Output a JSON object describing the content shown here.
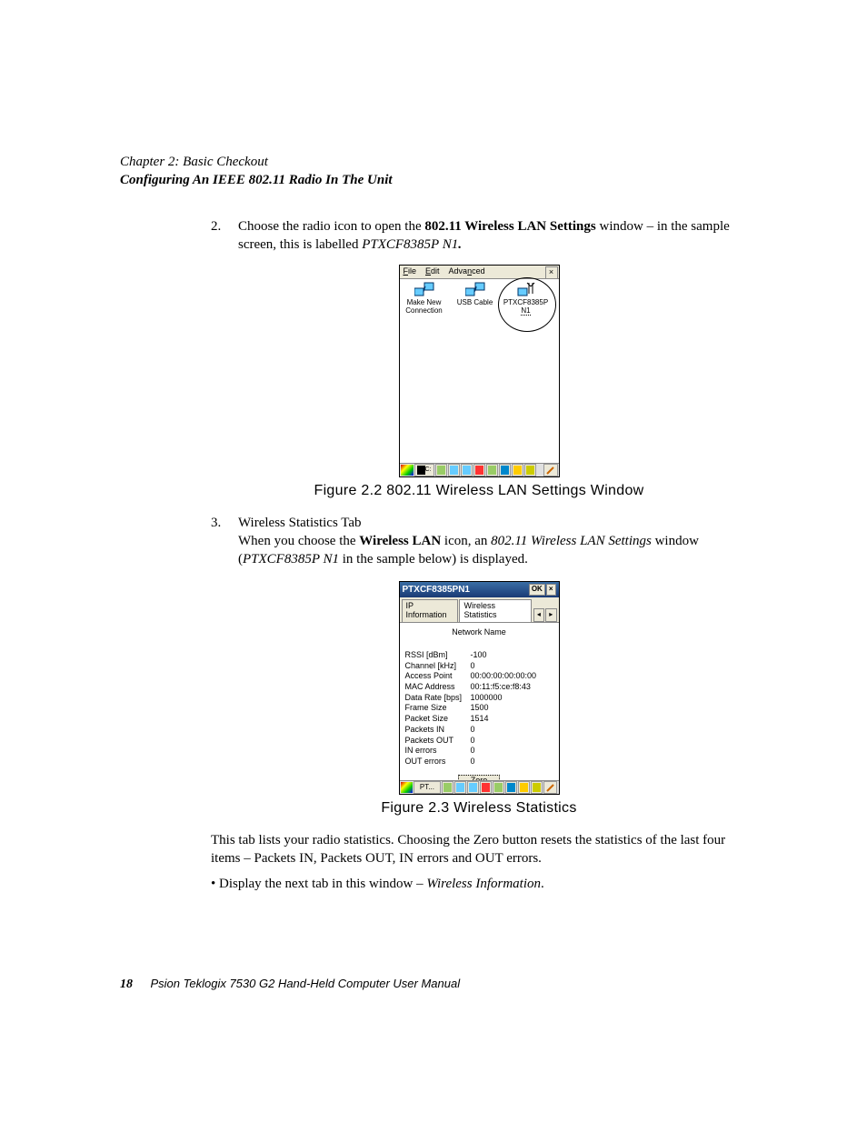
{
  "header": {
    "chapter": "Chapter  2:  Basic Checkout",
    "section": "Configuring An IEEE 802.11 Radio In The Unit"
  },
  "step2": {
    "num": "2.",
    "text_a": "Choose the radio icon to open the ",
    "bold": "802.11 Wireless LAN Settings",
    "text_b": " window – in the sample screen, this is labelled ",
    "italic": "PTXCF8385P N1",
    "period": "."
  },
  "shot1": {
    "menu": {
      "file": "File",
      "edit": "Edit",
      "advanced": "Advanced"
    },
    "close": "×",
    "icons": {
      "makenew_l1": "Make New",
      "makenew_l2": "Connection",
      "usb": "USB Cable",
      "ptx_l1": "PTXCF8385P",
      "ptx_l2": "N1"
    },
    "caption": "Figure 2.2 802.11 Wireless LAN Settings Window"
  },
  "step3": {
    "num": "3.",
    "title": "Wireless Statistics Tab",
    "line2_a": "When you choose the ",
    "line2_bold": "Wireless LAN",
    "line2_b": " icon, an ",
    "line2_i1": "802.11 Wireless LAN Settings",
    "line2_c": " window (",
    "line2_i2": "PTXCF8385P N1",
    "line2_d": " in the sample below) is displayed."
  },
  "shot2": {
    "title": "PTXCF8385PN1",
    "ok": "OK",
    "close": "×",
    "tab1": "IP Information",
    "tab2": "Wireless Statistics",
    "nn": "Network Name",
    "stats": [
      {
        "k": "RSSI [dBm]",
        "v": "-100"
      },
      {
        "k": "Channel [kHz]",
        "v": "0"
      },
      {
        "k": "Access Point",
        "v": "00:00:00:00:00:00"
      },
      {
        "k": "MAC Address",
        "v": "00:11:f5:ce:f8:43"
      },
      {
        "k": "Data Rate [bps]",
        "v": "1000000"
      },
      {
        "k": "Frame Size",
        "v": "1500"
      },
      {
        "k": "Packet Size",
        "v": "1514"
      },
      {
        "k": "Packets IN",
        "v": "0"
      },
      {
        "k": "Packets OUT",
        "v": "0"
      },
      {
        "k": "IN errors",
        "v": "0"
      },
      {
        "k": "OUT errors",
        "v": "0"
      }
    ],
    "zero": "Zero",
    "tb_cell": "PT...",
    "caption": "Figure 2.3 Wireless Statistics"
  },
  "para4": "This tab lists your radio statistics. Choosing the Zero button resets the statistics of the last four items – Packets IN, Packets OUT, IN errors and OUT errors.",
  "bullet1_a": "Display the next tab in this window – ",
  "bullet1_i": "Wireless Information",
  "bullet1_b": ".",
  "footer": {
    "page": "18",
    "manual": "Psion Teklogix 7530 G2 Hand-Held Computer User Manual"
  }
}
